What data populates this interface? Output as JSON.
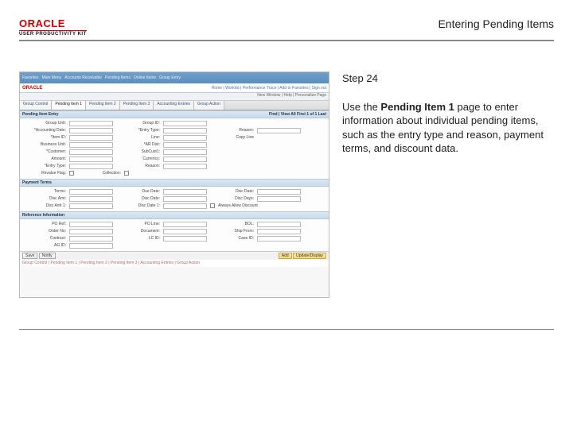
{
  "header": {
    "logo_text": "ORACLE",
    "logo_sub": "USER PRODUCTIVITY KIT",
    "doc_title": "Entering Pending Items"
  },
  "instructions": {
    "step": "Step 24",
    "body_pre": "Use the ",
    "body_bold": "Pending Item 1",
    "body_post": " page to enter information about individual pending items, such as the entry type and reason, payment terms, and discount data."
  },
  "screenshot": {
    "top_menu": [
      "Favorites",
      "Main Menu",
      "Accounts Receivable",
      "Pending Items",
      "Online Items",
      "Group Entry"
    ],
    "logo": "ORACLE",
    "logo_links": "Home | Worklist | Performance Trace | Add to Favorites | Sign out",
    "user_row": "New Window | Help | Personalize Page",
    "tabs": [
      "Group Control",
      "Pending Item 1",
      "Pending Item 2",
      "Pending Item 3",
      "Accounting Entries",
      "Group Action"
    ],
    "active_tab_index": 1,
    "section1": {
      "title": "Pending Item Entry",
      "toolbar": "Find | View All    First 1 of 1 Last",
      "fields": [
        [
          "Group Unit:",
          "Group ID:"
        ],
        [
          "*Accounting Date:",
          "*Entry Type:",
          "Reason:"
        ],
        [
          "*Item ID:",
          "Line:",
          "Copy Line"
        ],
        [
          "Business Unit:",
          "*AR Dist:"
        ],
        [
          "*Customer:",
          "SubCust1:"
        ],
        [
          "Amount:",
          "Currency:"
        ],
        [
          "*Entry Type:",
          "Reason:"
        ],
        [
          "Revalue Flag:",
          "Collection:"
        ]
      ]
    },
    "section2": {
      "title": "Payment Terms",
      "fields": [
        [
          "Terms:",
          "Due Date:",
          "Disc Date:"
        ],
        [
          "Disc Amt:",
          "Disc Date:",
          "Disc Days:"
        ],
        [
          "Disc Amt 1:",
          "Disc Date 1:",
          "Always Allow Discount"
        ]
      ]
    },
    "section3": {
      "title": "Reference Information",
      "fields": [
        [
          "PO Ref:",
          "PO Line:",
          "BOL:"
        ],
        [
          "Order No:",
          "Document:",
          "Ship From:"
        ],
        [
          "Contract:",
          "LC ID:",
          "Case ID:"
        ],
        [
          "AG ID:"
        ]
      ]
    },
    "footer_buttons_left": [
      "Save",
      "Notify"
    ],
    "footer_buttons_right": [
      "Add",
      "Update/Display"
    ],
    "breadcrumb": "Group Control | Pending Item 1 | Pending Item 2 | Pending Item 3 | Accounting Entries | Group Action"
  }
}
